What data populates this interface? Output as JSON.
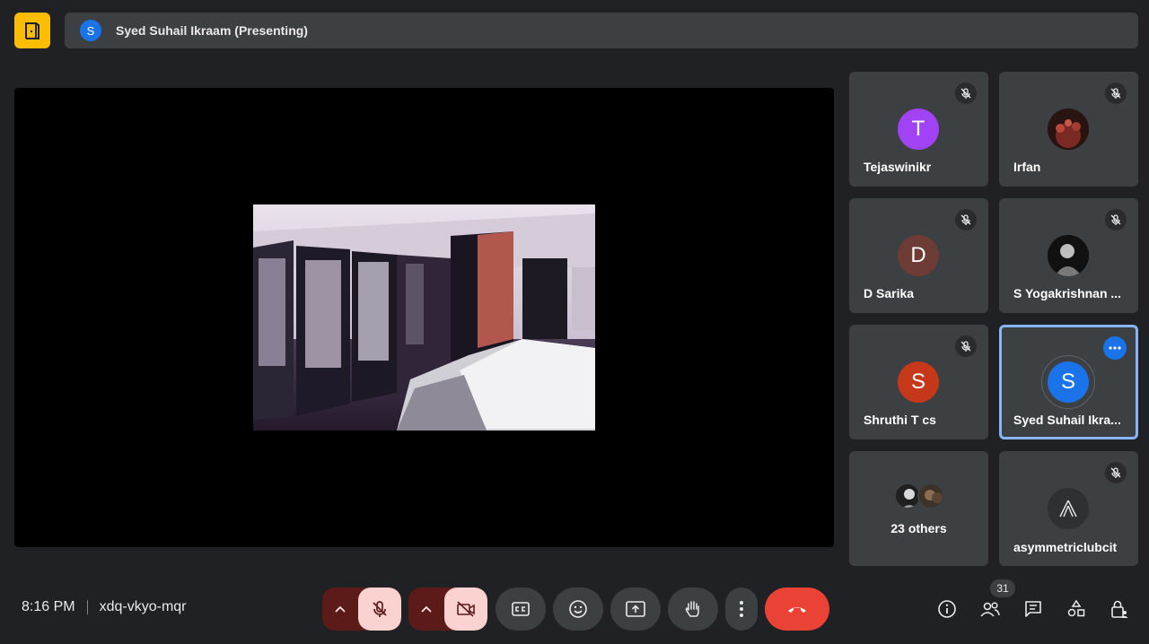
{
  "presenter": {
    "avatar_letter": "S",
    "label": "Syed Suhail Ikraam (Presenting)"
  },
  "participants": [
    {
      "name": "Tejaswinikr",
      "avatar_letter": "T",
      "avatar_color": "#a142f4",
      "muted": true
    },
    {
      "name": "Irfan",
      "avatar_letter": "",
      "avatar_color": "#3a1a1a",
      "muted": true
    },
    {
      "name": "D Sarika",
      "avatar_letter": "D",
      "avatar_color": "#6d3c34",
      "muted": true
    },
    {
      "name": "S Yogakrishnan ...",
      "avatar_letter": "",
      "avatar_color": "#1c1c1c",
      "muted": true
    },
    {
      "name": "Shruthi T cs",
      "avatar_letter": "S",
      "avatar_color": "#c5381a",
      "muted": true
    },
    {
      "name": "Syed Suhail Ikra...",
      "avatar_letter": "S",
      "avatar_color": "#1a73e8",
      "muted": false,
      "active": true
    },
    {
      "name": "23 others",
      "avatar_letter": "",
      "muted": false
    },
    {
      "name": "asymmetriclubcit",
      "avatar_letter": "",
      "avatar_color": "#2f3033",
      "muted": true
    }
  ],
  "meeting": {
    "time": "8:16 PM",
    "code": "xdq-vkyo-mqr"
  },
  "controls": [
    {
      "icon": "mic-off-icon",
      "state": "off"
    },
    {
      "icon": "camera-off-icon",
      "state": "off"
    },
    {
      "icon": "captions-icon"
    },
    {
      "icon": "emoji-icon"
    },
    {
      "icon": "present-icon"
    },
    {
      "icon": "raise-hand-icon"
    },
    {
      "icon": "more-options-icon"
    },
    {
      "icon": "end-call-icon"
    }
  ],
  "people_count": "31",
  "colors": {
    "background": "#202124",
    "surface": "#3c4043",
    "accent": "#1a73e8",
    "danger": "#ea4335",
    "brand": "#fbbc04"
  }
}
